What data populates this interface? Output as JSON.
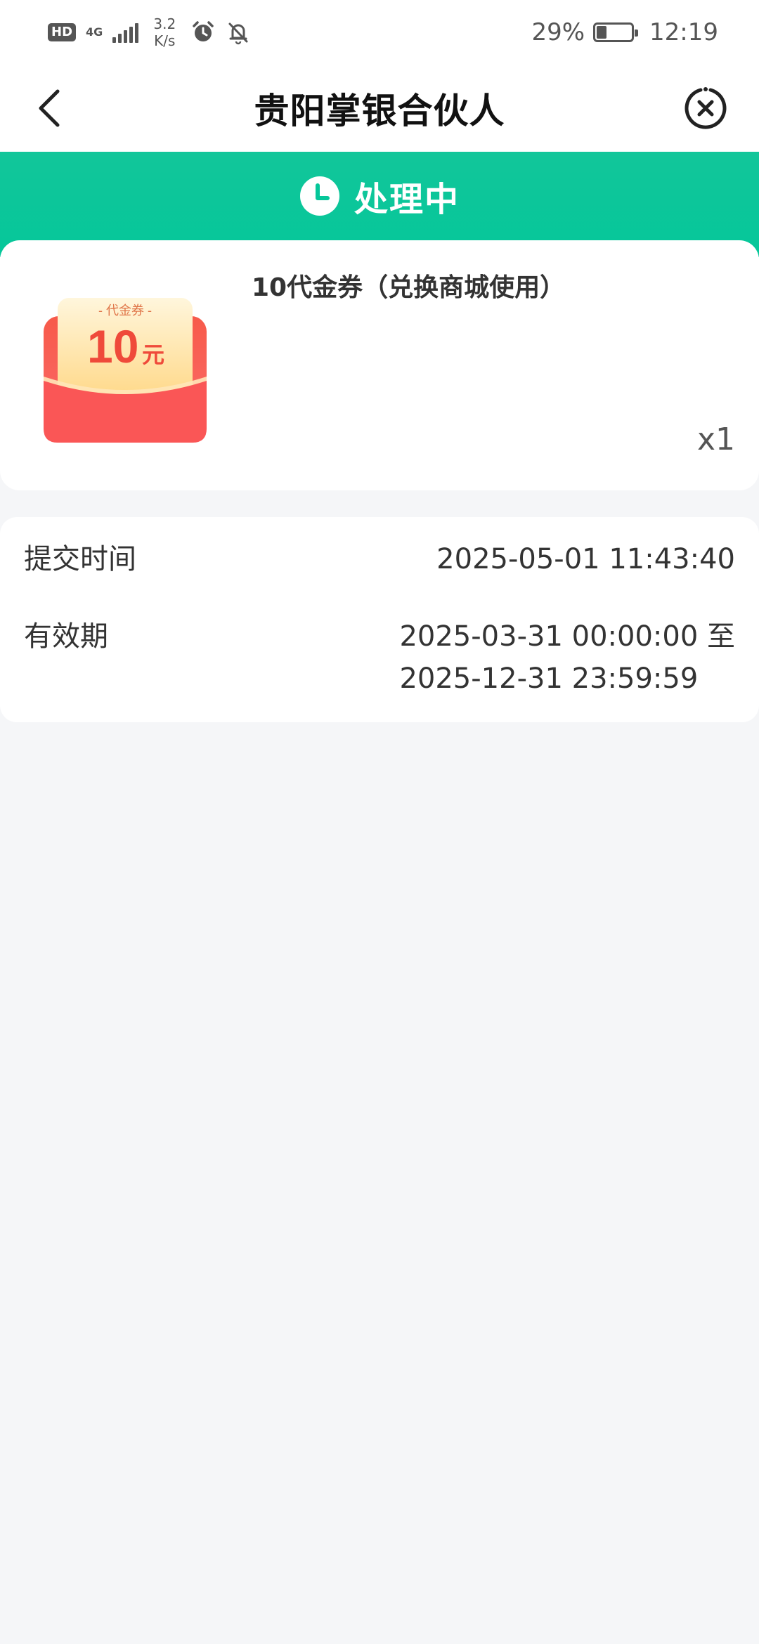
{
  "status_bar": {
    "hd": "HD",
    "network": "4G",
    "speed_value": "3.2",
    "speed_unit": "K/s",
    "battery_percent": "29%",
    "battery_level": 0.29,
    "time": "12:19"
  },
  "header": {
    "title": "贵阳掌银合伙人"
  },
  "status": {
    "text": "处理中",
    "color": "#05c79a"
  },
  "product": {
    "name": "10代金券（兑换商城使用）",
    "quantity": "x1",
    "voucher_label": "- 代金券 -",
    "voucher_amount": "10",
    "voucher_unit": "元"
  },
  "details": {
    "submit_time_label": "提交时间",
    "submit_time_value": "2025-05-01 11:43:40",
    "validity_label": "有效期",
    "validity_start": "2025-03-31 00:00:00 至",
    "validity_end": "2025-12-31 23:59:59"
  }
}
